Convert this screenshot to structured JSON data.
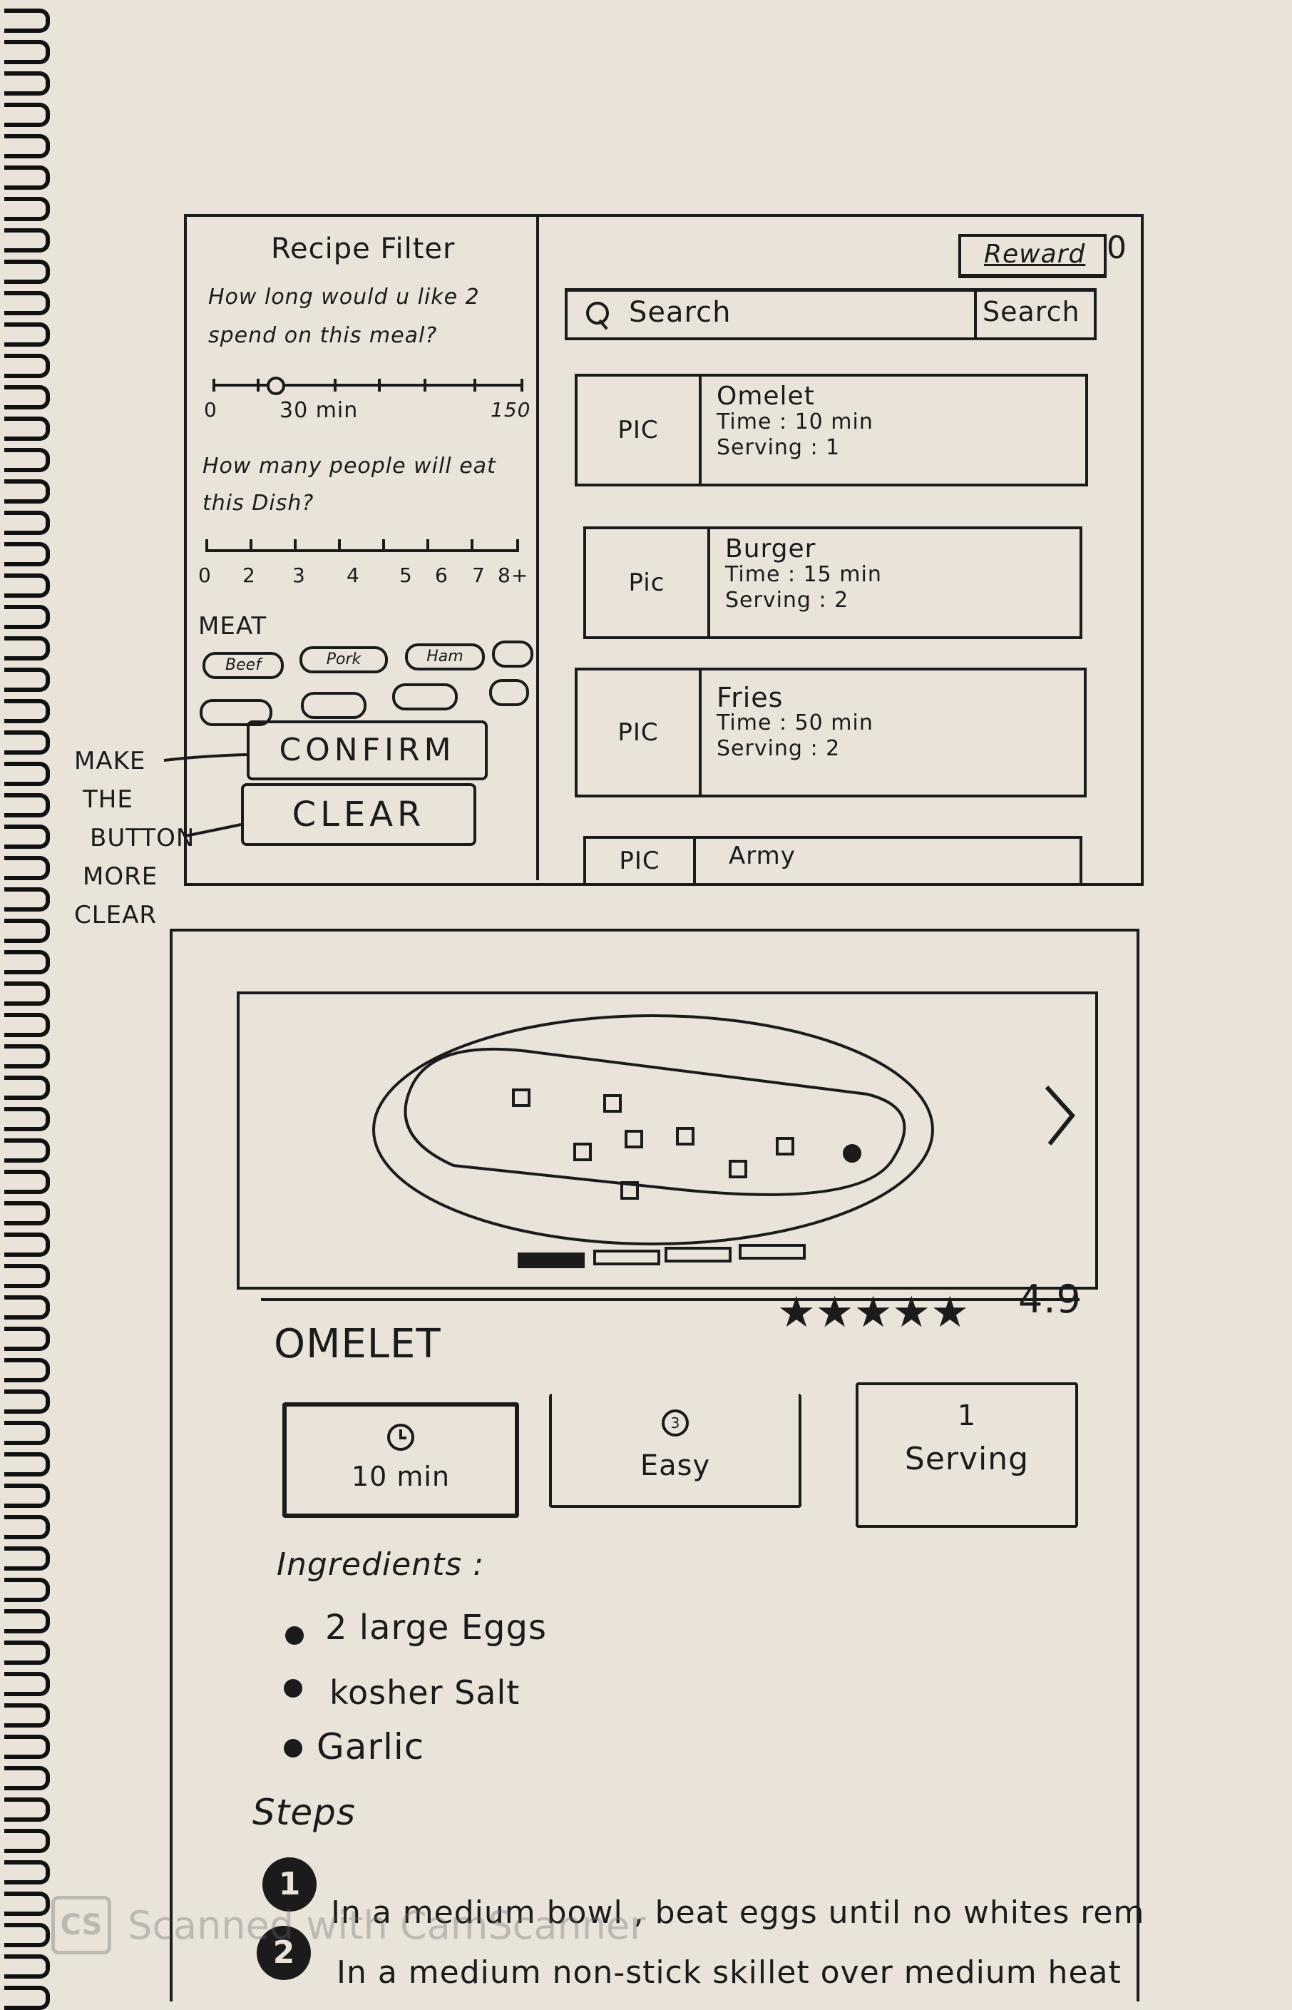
{
  "filter": {
    "title": "Recipe Filter",
    "q_time": "How long would u like 2 spend on this meal?",
    "time_min": "0",
    "time_value": "30 min",
    "time_max": "150",
    "time_selected": 30,
    "time_range": [
      0,
      150
    ],
    "q_people": "How many people will eat this Dish?",
    "people_ticks": [
      "0",
      "2",
      "3",
      "4",
      "5",
      "6",
      "7",
      "8+"
    ],
    "meat_heading": "MEAT",
    "meat_chips": [
      "Beef",
      "Pork",
      "Ham"
    ],
    "confirm_label": "CONFIRM",
    "clear_label": "CLEAR"
  },
  "annotation": {
    "lines": [
      "MAKE",
      "THE",
      "BUTTON",
      "MORE",
      "CLEAR"
    ]
  },
  "header": {
    "reward_label": "Reward",
    "reward_count": "0",
    "search_placeholder": "Search",
    "search_button": "Search"
  },
  "recipes": [
    {
      "pic": "PIC",
      "name": "Omelet",
      "time": "Time : 10 min",
      "serving": "Serving : 1"
    },
    {
      "pic": "Pic",
      "name": "Burger",
      "time": "Time : 15 min",
      "serving": "Serving : 2"
    },
    {
      "pic": "PIC",
      "name": "Fries",
      "time": "Time : 50 min",
      "serving": "Serving : 2"
    },
    {
      "pic": "PIC",
      "name": "Army",
      "time": "",
      "serving": ""
    }
  ],
  "detail": {
    "rating": "4.9",
    "rating_value": 4.9,
    "rating_stars": 5,
    "title": "OMELET",
    "time": "10 min",
    "difficulty": "Easy",
    "serving_count": "1",
    "serving_label": "Serving",
    "carousel_pages": 4,
    "carousel_active": 0,
    "ingredients_heading": "Ingredients :",
    "ingredients": [
      "2 large Eggs",
      "kosher Salt",
      "Garlic"
    ],
    "steps_heading": "Steps",
    "steps": [
      {
        "num": "1",
        "text": "In a medium bowl , beat eggs until no whites rem"
      },
      {
        "num": "2",
        "text": "In a medium non-stick skillet over medium heat"
      }
    ]
  },
  "watermark": "Scanned with CamScanner"
}
